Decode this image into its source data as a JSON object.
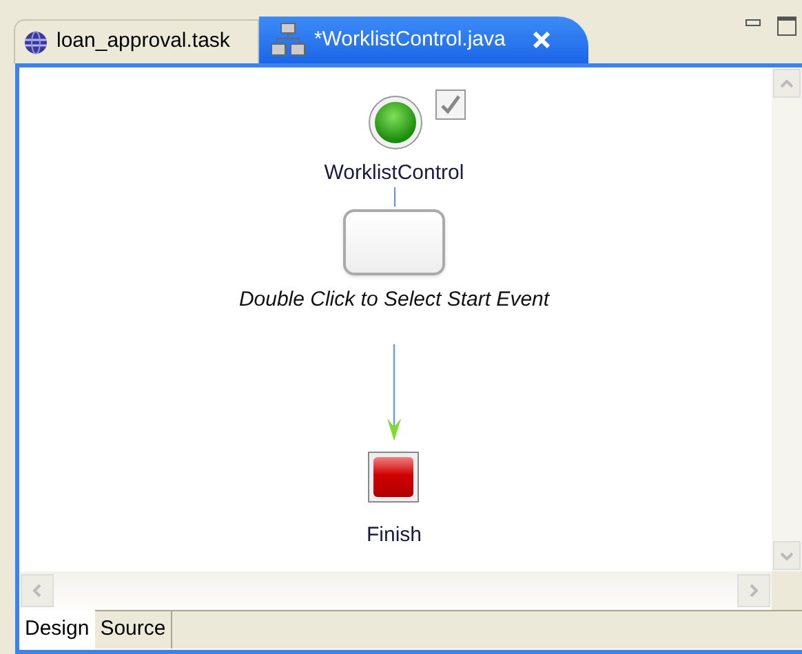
{
  "editor_tabs": [
    {
      "label": "loan_approval.task",
      "selected": false,
      "kind": "task"
    },
    {
      "label": "*WorklistControl.java",
      "selected": true,
      "kind": "process"
    }
  ],
  "diagram": {
    "start": {
      "label": "WorklistControl",
      "checked": true
    },
    "task": {
      "label": "Double Click to Select Start Event"
    },
    "finish": {
      "label": "Finish"
    }
  },
  "bottom_tabs": [
    {
      "label": "Design",
      "selected": true
    },
    {
      "label": "Source",
      "selected": false
    }
  ]
}
